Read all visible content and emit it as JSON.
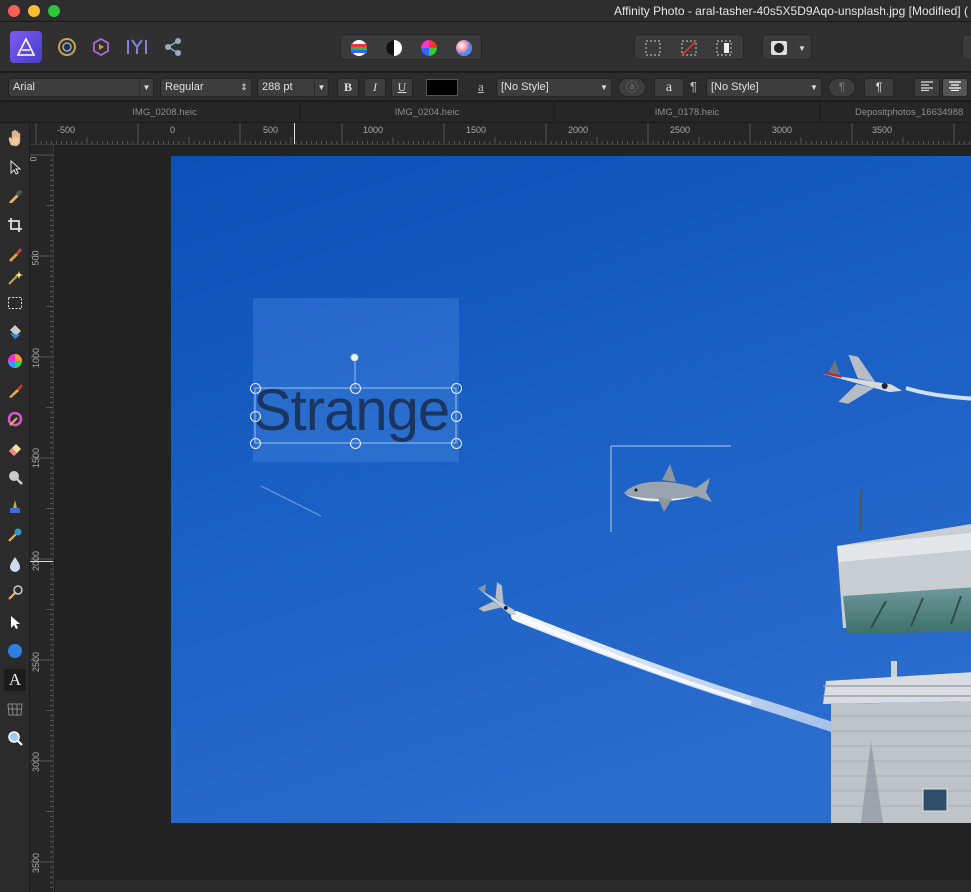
{
  "window": {
    "title": "Affinity Photo - aral-tasher-40s5X5D9Aqo-unsplash.jpg [Modified] ("
  },
  "context": {
    "font_family": "Arial",
    "font_style": "Regular",
    "font_size": "288 pt",
    "bold": "B",
    "italic": "I",
    "underline": "U",
    "char_style_label": "a",
    "char_style": "[No Style]",
    "para_mark": "¶",
    "para_style": "[No Style]",
    "text_color": "#000000"
  },
  "tabs": [
    "IMG_0208.heic",
    "IMG_0204.heic",
    "IMG_0178.heic",
    "Depositphotos_16634988"
  ],
  "ruler": {
    "unit": "px",
    "h_labels": [
      "-500",
      "0",
      "500",
      "1000",
      "1500",
      "2000",
      "2500",
      "3000",
      "3500"
    ],
    "v_labels": [
      "0",
      "500",
      "1000",
      "1500",
      "2000",
      "2500",
      "3000",
      "3500"
    ]
  },
  "canvas": {
    "text_layer": "Strange"
  },
  "colors": {
    "accent": "#5b6ee1",
    "sky": "#1a5fbf",
    "selection": "#2a7be0"
  }
}
